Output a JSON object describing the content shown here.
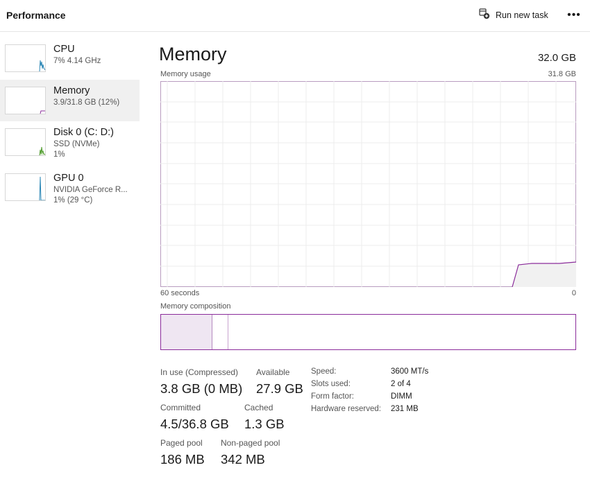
{
  "header": {
    "title": "Performance",
    "run_task_label": "Run new task",
    "more_icon": "ellipsis-icon"
  },
  "sidebar": {
    "items": [
      {
        "name": "CPU",
        "sub1": "7% 4.14 GHz",
        "sub2": "",
        "color": "#2a86b5",
        "selected": false
      },
      {
        "name": "Memory",
        "sub1": "3.9/31.8 GB (12%)",
        "sub2": "",
        "color": "#8a2b9a",
        "selected": true
      },
      {
        "name": "Disk 0 (C: D:)",
        "sub1": "SSD (NVMe)",
        "sub2": "1%",
        "color": "#4d9a2b",
        "selected": false
      },
      {
        "name": "GPU 0",
        "sub1": "NVIDIA GeForce R...",
        "sub2": "1% (29 °C)",
        "color": "#2a86b5",
        "selected": false
      }
    ]
  },
  "main": {
    "title": "Memory",
    "total": "32.0 GB",
    "usage_label": "Memory usage",
    "usage_max": "31.8 GB",
    "x_left": "60 seconds",
    "x_right": "0",
    "composition_label": "Memory composition",
    "accent_color": "#8a2b9a"
  },
  "stats": {
    "in_use_label": "In use (Compressed)",
    "in_use_value": "3.8 GB (0 MB)",
    "available_label": "Available",
    "available_value": "27.9 GB",
    "committed_label": "Committed",
    "committed_value": "4.5/36.8 GB",
    "cached_label": "Cached",
    "cached_value": "1.3 GB",
    "paged_label": "Paged pool",
    "paged_value": "186 MB",
    "nonpaged_label": "Non-paged pool",
    "nonpaged_value": "342 MB"
  },
  "specs": {
    "speed_label": "Speed:",
    "speed_value": "3600 MT/s",
    "slots_label": "Slots used:",
    "slots_value": "2 of 4",
    "form_label": "Form factor:",
    "form_value": "DIMM",
    "hw_label": "Hardware reserved:",
    "hw_value": "231 MB"
  }
}
